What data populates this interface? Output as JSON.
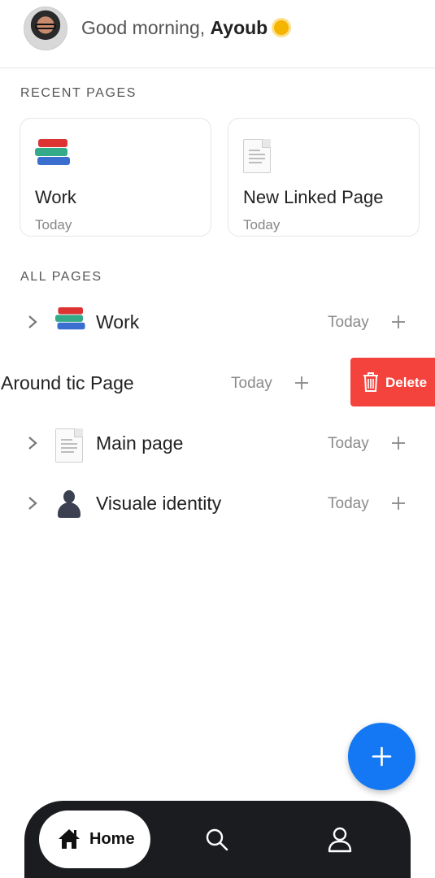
{
  "header": {
    "greeting": "Good morning,",
    "user_name": "Ayoub",
    "greeting_icon": "sun-icon"
  },
  "recent": {
    "title": "RECENT PAGES",
    "cards": [
      {
        "title": "Work",
        "date": "Today",
        "icon": "books-icon"
      },
      {
        "title": "New Linked Page",
        "date": "Today",
        "icon": "document-icon"
      }
    ]
  },
  "all_pages": {
    "title": "ALL PAGES",
    "rows": [
      {
        "label": "Work",
        "date": "Today",
        "icon": "books-icon"
      },
      {
        "label": "Around tic Page",
        "date": "Today",
        "action": "Delete"
      },
      {
        "label": "Main page",
        "date": "Today",
        "icon": "document-icon"
      },
      {
        "label": "Visuale identity",
        "date": "Today",
        "icon": "person-silhouette-icon"
      }
    ]
  },
  "nav": {
    "home_label": "Home"
  },
  "colors": {
    "accent": "#1478f5",
    "delete": "#f4433c",
    "nav_bg": "#1b1c20"
  }
}
